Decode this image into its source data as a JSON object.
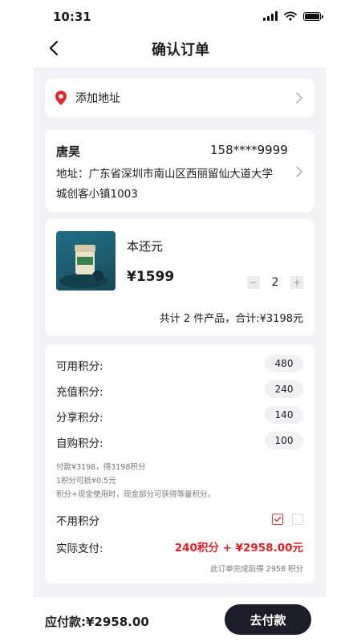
{
  "status_bar": {
    "time": "10:31"
  },
  "header": {
    "title": "确认订单"
  },
  "address_add": {
    "label": "添加地址"
  },
  "address": {
    "name": "唐昊",
    "phone": "158****9999",
    "line1": "地址：广东省深圳市南山区西丽留仙大道大学",
    "line2": "城创客小镇1003"
  },
  "product": {
    "name": "本还元",
    "price": "¥1599",
    "quantity": "2",
    "minus": "−",
    "plus": "+",
    "summary": "共计 2 件产品，合计:¥3198元"
  },
  "points": {
    "rows": [
      {
        "label": "可用积分:",
        "value": "480"
      },
      {
        "label": "充值积分:",
        "value": "240"
      },
      {
        "label": "分享积分:",
        "value": "140"
      },
      {
        "label": "自购积分:",
        "value": "100"
      }
    ],
    "notes": [
      "付款¥3198，得3198积分",
      "1积分可抵¥0.5元",
      "积分+现金使用时，现金部分可获得等量积分。"
    ],
    "no_points_label": "不用积分",
    "actual_pay_label": "实际支付:",
    "actual_pay_value": "240积分 + ¥2958.00元",
    "earn_note": "此订单完成后得 2958 积分"
  },
  "footer": {
    "due": "应付款:¥2958.00",
    "pay_button": "去付款"
  },
  "colors": {
    "accent_red": "#d8232a",
    "button_dark": "#1d1d29",
    "background": "#f2f2f6"
  }
}
